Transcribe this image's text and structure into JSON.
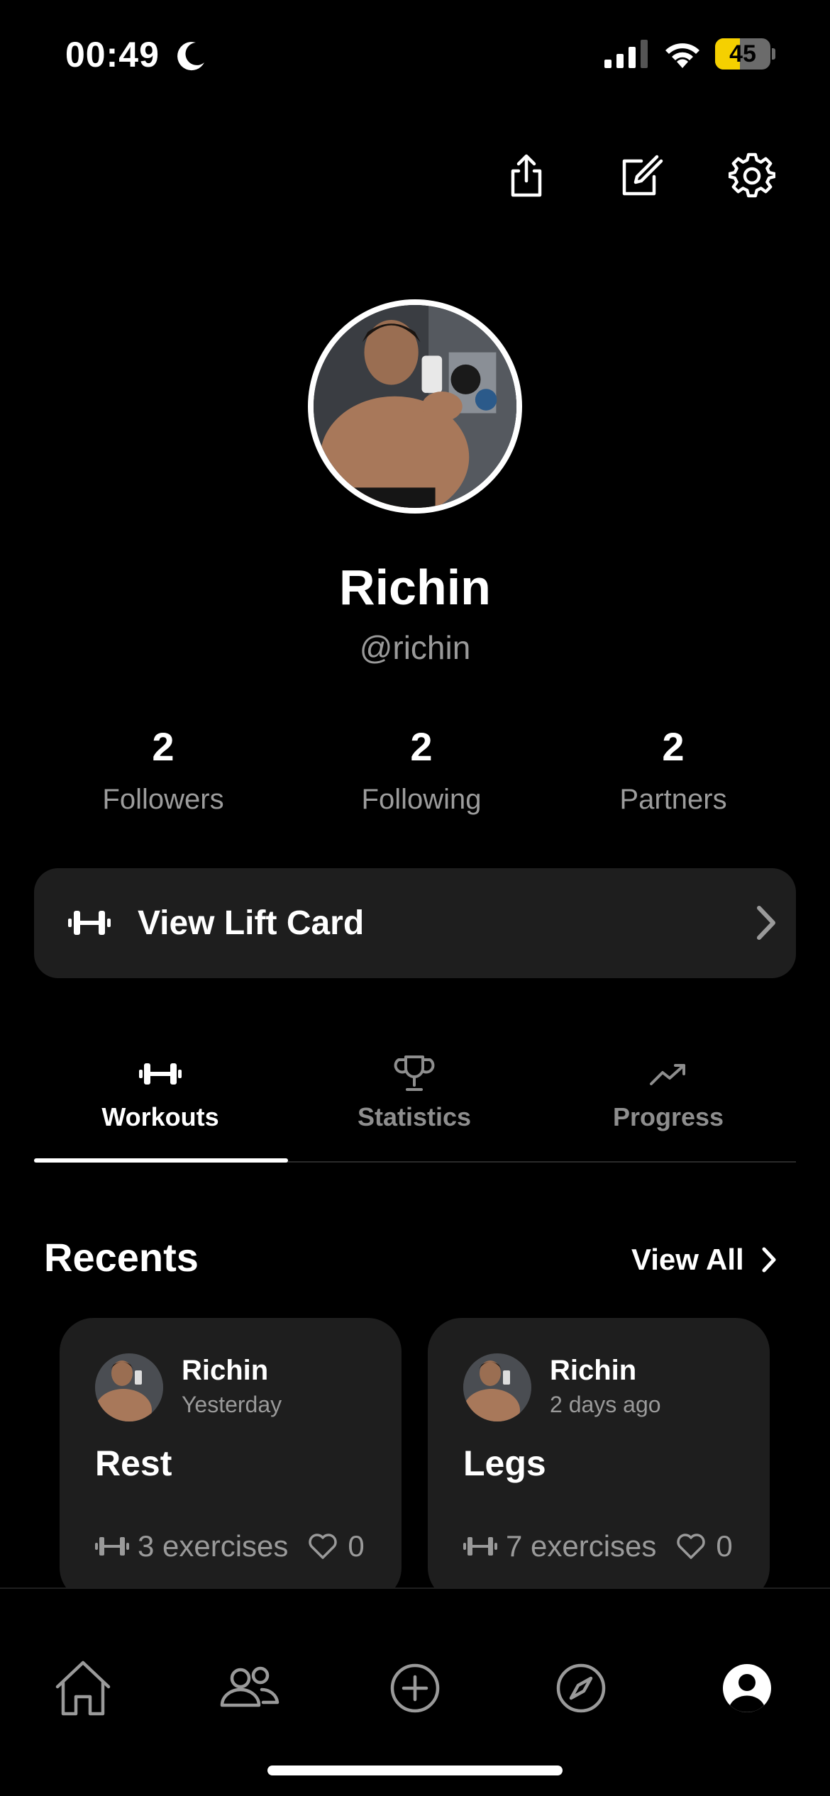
{
  "status_bar": {
    "time": "00:49",
    "battery_percent": "45",
    "battery_level": 0.45,
    "battery_color": "#f5d000",
    "icons": [
      "moon-icon",
      "signal-icon",
      "wifi-icon",
      "battery-icon"
    ]
  },
  "header": {
    "actions": [
      "share-icon",
      "edit-icon",
      "gear-icon"
    ]
  },
  "profile": {
    "name": "Richin",
    "handle": "@richin",
    "stats": [
      {
        "value": "2",
        "label": "Followers"
      },
      {
        "value": "2",
        "label": "Following"
      },
      {
        "value": "2",
        "label": "Partners"
      }
    ]
  },
  "lift_card": {
    "label": "View Lift Card",
    "icon": "dumbbell-icon"
  },
  "tabs": [
    {
      "label": "Workouts",
      "icon": "dumbbell-icon",
      "active": true
    },
    {
      "label": "Statistics",
      "icon": "trophy-icon",
      "active": false
    },
    {
      "label": "Progress",
      "icon": "trend-up-icon",
      "active": false
    }
  ],
  "recents": {
    "title": "Recents",
    "view_all": "View All",
    "cards": [
      {
        "author": "Richin",
        "time": "Yesterday",
        "title": "Rest",
        "exercises": "3 exercises",
        "likes": "0"
      },
      {
        "author": "Richin",
        "time": "2 days ago",
        "title": "Legs",
        "exercises": "7 exercises",
        "likes": "0"
      }
    ]
  },
  "bottom_nav": {
    "items": [
      "home-icon",
      "people-icon",
      "add-circle-icon",
      "compass-icon",
      "profile-icon"
    ],
    "active": "profile-icon"
  },
  "colors": {
    "background": "#000000",
    "surface": "#1e1e1e",
    "muted_text": "#9a9a9a"
  }
}
